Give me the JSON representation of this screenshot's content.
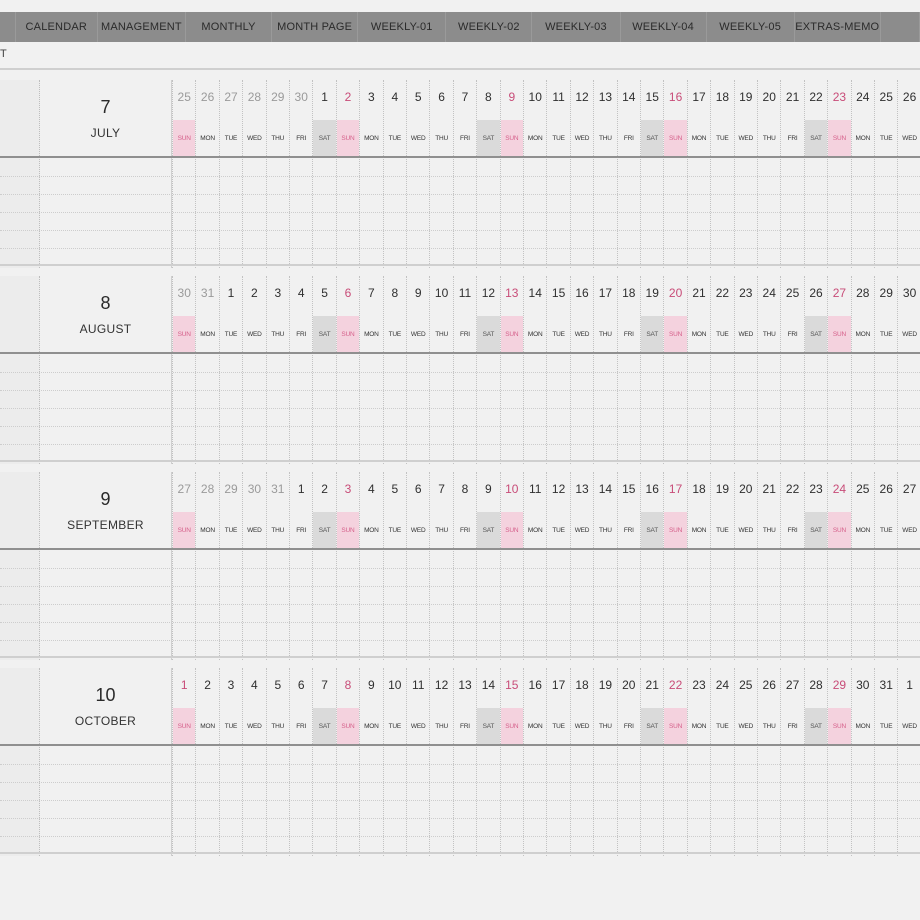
{
  "nav": {
    "tabs": [
      {
        "label": "",
        "w": 16
      },
      {
        "label": "CALENDAR",
        "w": 84
      },
      {
        "label": "MANAGEMENT",
        "w": 90
      },
      {
        "label": "MONTHLY",
        "w": 88
      },
      {
        "label": "MONTH PAGE",
        "w": 88
      },
      {
        "label": "WEEKLY-01",
        "w": 90
      },
      {
        "label": "WEEKLY-02",
        "w": 88
      },
      {
        "label": "WEEKLY-03",
        "w": 90
      },
      {
        "label": "WEEKLY-04",
        "w": 88
      },
      {
        "label": "WEEKLY-05",
        "w": 90
      },
      {
        "label": "EXTRAS-MEMO",
        "w": 88
      },
      {
        "label": "",
        "w": 40
      }
    ]
  },
  "breadcrumb": "T",
  "months": [
    {
      "number": "7",
      "name": "JULY",
      "days": [
        "25",
        "26",
        "27",
        "28",
        "29",
        "30",
        "1",
        "2",
        "3",
        "4",
        "5",
        "6",
        "7",
        "8",
        "9",
        "10",
        "11",
        "12",
        "13",
        "14",
        "15",
        "16",
        "17",
        "18",
        "19",
        "20",
        "21",
        "22",
        "23",
        "24",
        "25",
        "26"
      ],
      "faded_count": 6,
      "first_dow_index": 0
    },
    {
      "number": "8",
      "name": "AUGUST",
      "days": [
        "30",
        "31",
        "1",
        "2",
        "3",
        "4",
        "5",
        "6",
        "7",
        "8",
        "9",
        "10",
        "11",
        "12",
        "13",
        "14",
        "15",
        "16",
        "17",
        "18",
        "19",
        "20",
        "21",
        "22",
        "23",
        "24",
        "25",
        "26",
        "27",
        "28",
        "29",
        "30"
      ],
      "faded_count": 2,
      "first_dow_index": 0
    },
    {
      "number": "9",
      "name": "SEPTEMBER",
      "days": [
        "27",
        "28",
        "29",
        "30",
        "31",
        "1",
        "2",
        "3",
        "4",
        "5",
        "6",
        "7",
        "8",
        "9",
        "10",
        "11",
        "12",
        "13",
        "14",
        "15",
        "16",
        "17",
        "18",
        "19",
        "20",
        "21",
        "22",
        "23",
        "24",
        "25",
        "26",
        "27"
      ],
      "faded_count": 5,
      "first_dow_index": 0
    },
    {
      "number": "10",
      "name": "OCTOBER",
      "days": [
        "1",
        "2",
        "3",
        "4",
        "5",
        "6",
        "7",
        "8",
        "9",
        "10",
        "11",
        "12",
        "13",
        "14",
        "15",
        "16",
        "17",
        "18",
        "19",
        "20",
        "21",
        "22",
        "23",
        "24",
        "25",
        "26",
        "27",
        "28",
        "29",
        "30",
        "31",
        "1"
      ],
      "faded_count": 0,
      "first_dow_index": 0
    }
  ],
  "weekday_labels": [
    "SUN",
    "MON",
    "TUE",
    "WED",
    "THU",
    "FRI",
    "SAT"
  ],
  "colors": {
    "sunday": "#d55f8a",
    "sunday_bg": "#f4d2de",
    "saturday_bg": "#dadada",
    "nav_bg": "#8a8a8a"
  }
}
